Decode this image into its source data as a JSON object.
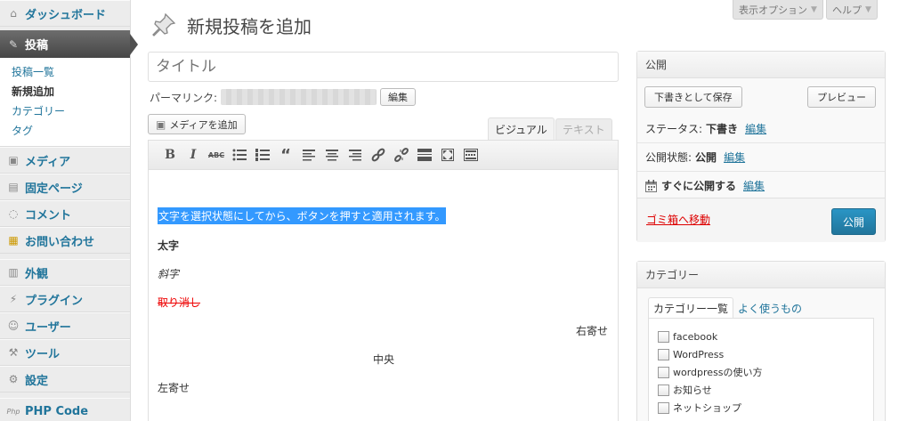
{
  "sidebar": {
    "items": [
      {
        "label": "ダッシュボード",
        "icon": "home-icon"
      },
      {
        "label": "投稿",
        "icon": "pin-icon"
      },
      {
        "label": "メディア",
        "icon": "media-icon"
      },
      {
        "label": "固定ページ",
        "icon": "pages-icon"
      },
      {
        "label": "コメント",
        "icon": "comment-icon"
      },
      {
        "label": "お問い合わせ",
        "icon": "contact-icon"
      },
      {
        "label": "外観",
        "icon": "appearance-icon"
      },
      {
        "label": "プラグイン",
        "icon": "plugin-icon"
      },
      {
        "label": "ユーザー",
        "icon": "users-icon"
      },
      {
        "label": "ツール",
        "icon": "tools-icon"
      },
      {
        "label": "設定",
        "icon": "settings-icon"
      },
      {
        "label": "PHP Code",
        "icon": "php-code-icon"
      }
    ],
    "submenu": [
      "投稿一覧",
      "新規追加",
      "カテゴリー",
      "タグ"
    ]
  },
  "screen_options": {
    "display": "表示オプション",
    "help": "ヘルプ"
  },
  "page": {
    "title": "新規投稿を追加",
    "title_placeholder": "タイトル",
    "permalink_label": "パーマリンク:",
    "edit_label": "編集",
    "add_media": "メディアを追加",
    "tab_visual": "ビジュアル",
    "tab_text": "テキスト"
  },
  "toolbar": {
    "bold": "B",
    "italic": "I",
    "strike": "ABC",
    "quote": "“"
  },
  "editor": {
    "selected": "文字を選択状態にしてから、ボタンを押すと適用されます。",
    "bold": "太字",
    "italic": "斜字",
    "strike": "取り消し",
    "right": "右寄せ",
    "center": "中央",
    "left": "左寄せ"
  },
  "publish": {
    "heading": "公開",
    "save_draft": "下書きとして保存",
    "preview": "プレビュー",
    "status_label": "ステータス:",
    "status_value": "下書き",
    "visibility_label": "公開状態:",
    "visibility_value": "公開",
    "schedule_label": "すぐに公開する",
    "edit": "編集",
    "trash": "ゴミ箱へ移動",
    "publish_button": "公開"
  },
  "category": {
    "heading": "カテゴリー",
    "tab_all": "カテゴリー一覧",
    "tab_popular": "よく使うもの",
    "items": [
      "facebook",
      "WordPress",
      "wordpressの使い方",
      "お知らせ",
      "ネットショップ"
    ]
  }
}
